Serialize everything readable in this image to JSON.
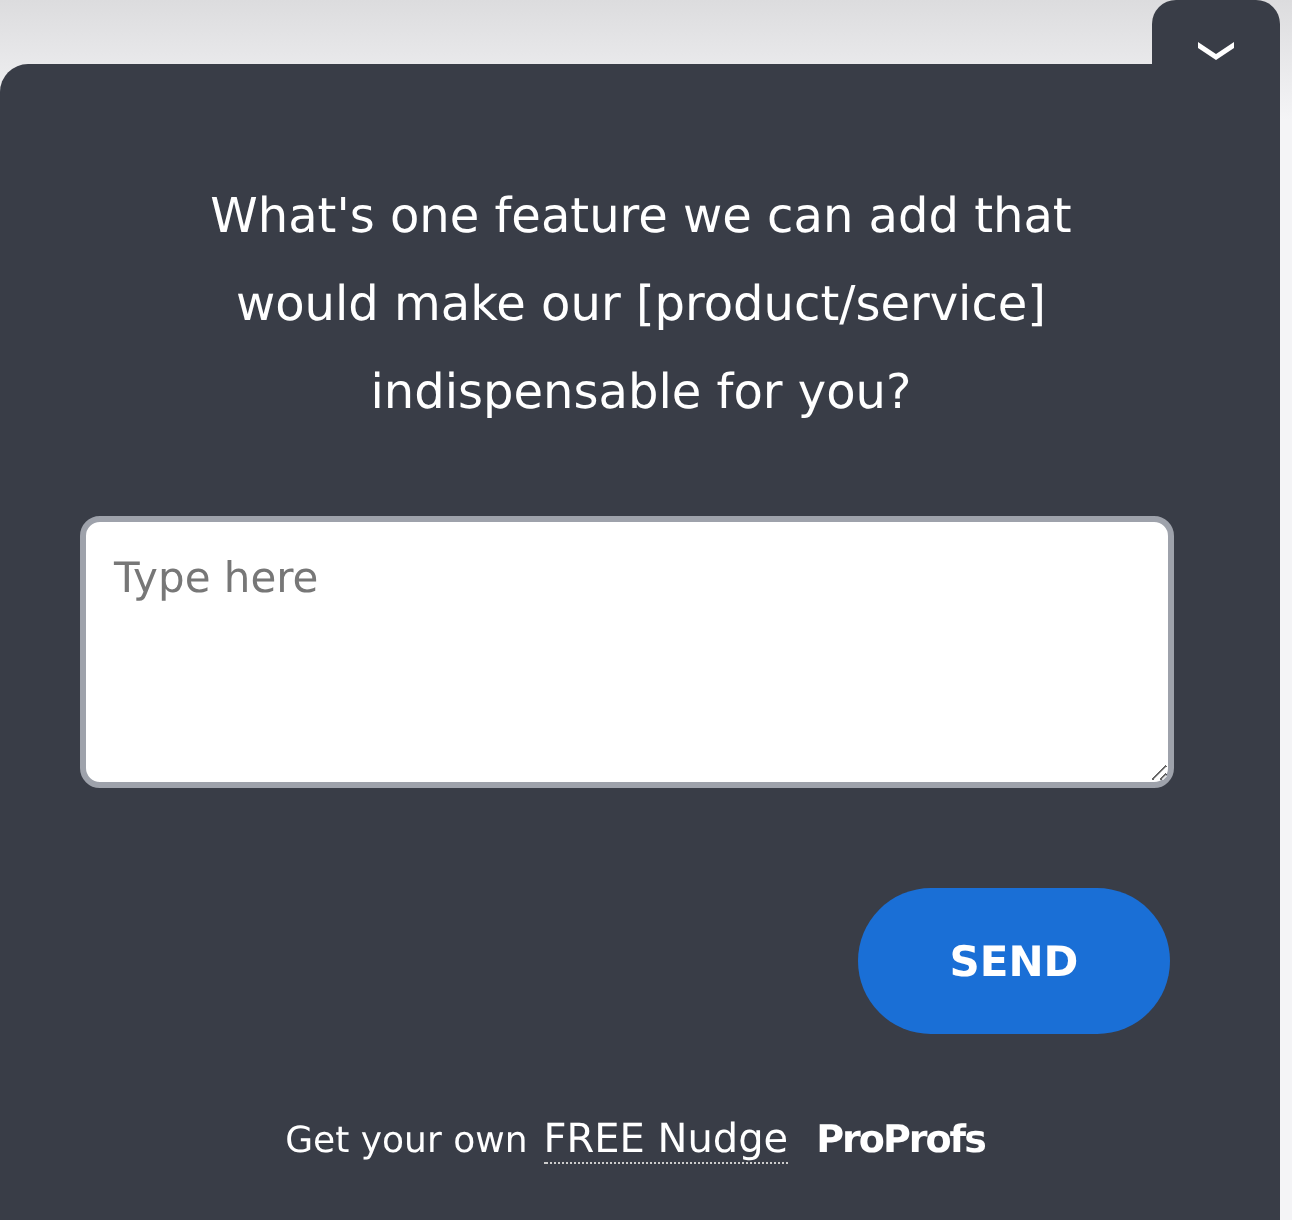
{
  "question": "What's one feature we can add that would make our [product/service] indispensable for you?",
  "answer": {
    "placeholder": "Type here"
  },
  "send_button": "SEND",
  "footer": {
    "text": "Get your own",
    "link": "FREE Nudge",
    "brand": "ProProfs"
  }
}
